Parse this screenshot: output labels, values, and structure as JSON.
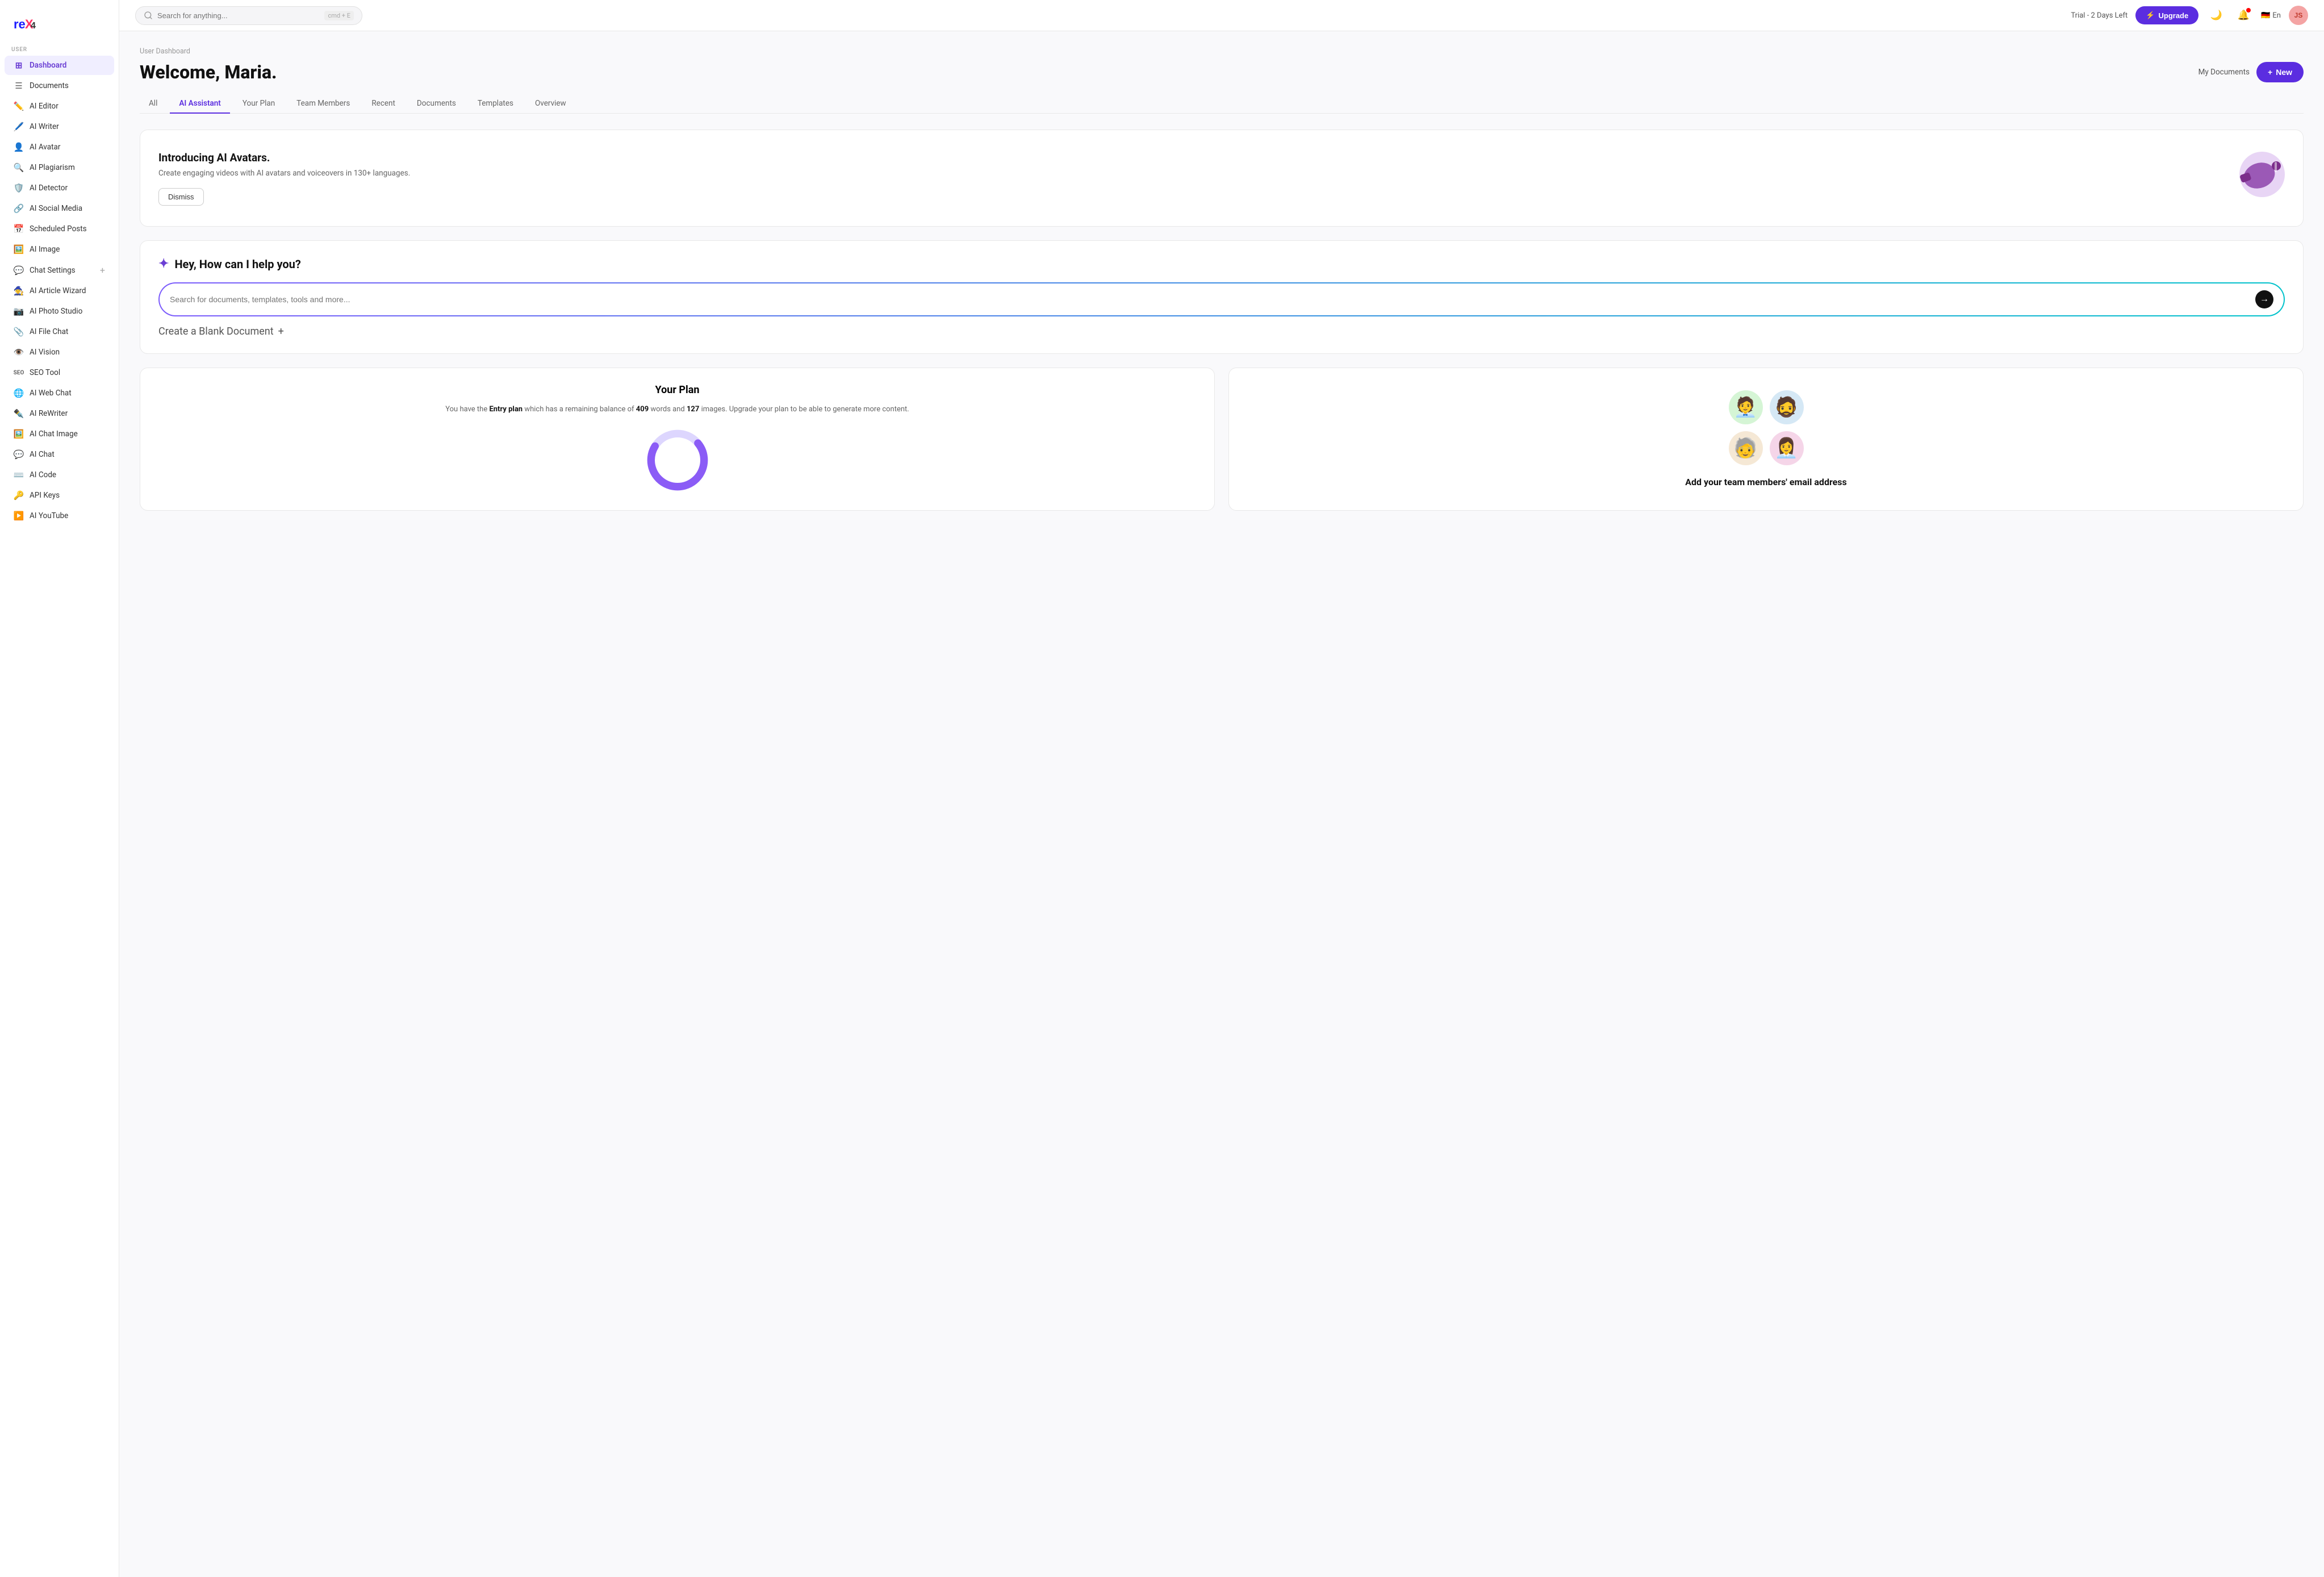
{
  "logo": {
    "text": "reX4",
    "alt": "reX4 logo"
  },
  "topbar": {
    "search_placeholder": "Search for anything...",
    "shortcut": "cmd + E",
    "trial_label": "Trial - 2 Days Left",
    "upgrade_label": "Upgrade",
    "lang": "En",
    "user_initials": "JS"
  },
  "sidebar": {
    "section_label": "USER",
    "items": [
      {
        "id": "dashboard",
        "label": "Dashboard",
        "icon": "⊞",
        "active": true
      },
      {
        "id": "documents",
        "label": "Documents",
        "icon": "📄",
        "active": false
      },
      {
        "id": "ai-editor",
        "label": "AI Editor",
        "icon": "✏️",
        "active": false
      },
      {
        "id": "ai-writer",
        "label": "AI Writer",
        "icon": "🖊️",
        "active": false
      },
      {
        "id": "ai-avatar",
        "label": "AI Avatar",
        "icon": "👤",
        "active": false
      },
      {
        "id": "ai-plagiarism",
        "label": "AI Plagiarism",
        "icon": "🔍",
        "active": false
      },
      {
        "id": "ai-detector",
        "label": "AI Detector",
        "icon": "🛡️",
        "active": false
      },
      {
        "id": "ai-social-media",
        "label": "AI Social Media",
        "icon": "🔗",
        "active": false
      },
      {
        "id": "scheduled-posts",
        "label": "Scheduled Posts",
        "icon": "📅",
        "active": false
      },
      {
        "id": "ai-image",
        "label": "AI Image",
        "icon": "🖼️",
        "active": false
      },
      {
        "id": "chat-settings",
        "label": "Chat Settings",
        "icon": "💬",
        "active": false,
        "has_plus": true
      },
      {
        "id": "ai-article-wizard",
        "label": "AI Article Wizard",
        "icon": "🧙",
        "active": false
      },
      {
        "id": "ai-photo-studio",
        "label": "AI Photo Studio",
        "icon": "📷",
        "active": false
      },
      {
        "id": "ai-file-chat",
        "label": "AI File Chat",
        "icon": "📎",
        "active": false
      },
      {
        "id": "ai-vision",
        "label": "AI Vision",
        "icon": "👁️",
        "active": false
      },
      {
        "id": "seo-tool",
        "label": "SEO Tool",
        "icon": "SEO",
        "active": false,
        "is_seo": true
      },
      {
        "id": "ai-web-chat",
        "label": "AI Web Chat",
        "icon": "🌐",
        "active": false
      },
      {
        "id": "ai-rewriter",
        "label": "AI ReWriter",
        "icon": "✒️",
        "active": false
      },
      {
        "id": "ai-chat-image",
        "label": "AI Chat Image",
        "icon": "🖼️",
        "active": false
      },
      {
        "id": "ai-chat",
        "label": "AI Chat",
        "icon": "💬",
        "active": false
      },
      {
        "id": "ai-code",
        "label": "AI Code",
        "icon": "⌨️",
        "active": false
      },
      {
        "id": "api-keys",
        "label": "API Keys",
        "icon": "🔑",
        "active": false
      },
      {
        "id": "ai-youtube",
        "label": "AI YouTube",
        "icon": "▶️",
        "active": false
      }
    ]
  },
  "breadcrumb": "User Dashboard",
  "page_title": "Welcome, Maria.",
  "new_button": "New",
  "tabs": [
    {
      "id": "all",
      "label": "All"
    },
    {
      "id": "ai-assistant",
      "label": "AI Assistant",
      "active": true
    },
    {
      "id": "your-plan",
      "label": "Your Plan"
    },
    {
      "id": "team-members",
      "label": "Team Members"
    },
    {
      "id": "recent",
      "label": "Recent"
    },
    {
      "id": "documents",
      "label": "Documents"
    },
    {
      "id": "templates",
      "label": "Templates"
    },
    {
      "id": "overview",
      "label": "Overview"
    }
  ],
  "banner": {
    "title": "Introducing AI Avatars.",
    "description": "Create engaging videos with AI avatars and voiceovers in 130+ languages.",
    "dismiss_label": "Dismiss",
    "icon": "📣"
  },
  "help_section": {
    "title": "Hey, How can I help you?",
    "search_placeholder": "Search for documents, templates, tools and more...",
    "create_doc_label": "Create a Blank Document"
  },
  "plan_card": {
    "title": "Your Plan",
    "description_prefix": "You have the",
    "plan_name": "Entry plan",
    "description_mid": "which has a remaining balance of",
    "words_count": "409",
    "words_label": "words and",
    "images_count": "127",
    "images_label": "images. Upgrade your plan to be able to generate more content.",
    "donut": {
      "used_pct": 70,
      "remaining_pct": 30,
      "used_color": "#8b5cf6",
      "remaining_color": "#ddd6fe"
    }
  },
  "team_card": {
    "title": "Add your team members' email address"
  }
}
